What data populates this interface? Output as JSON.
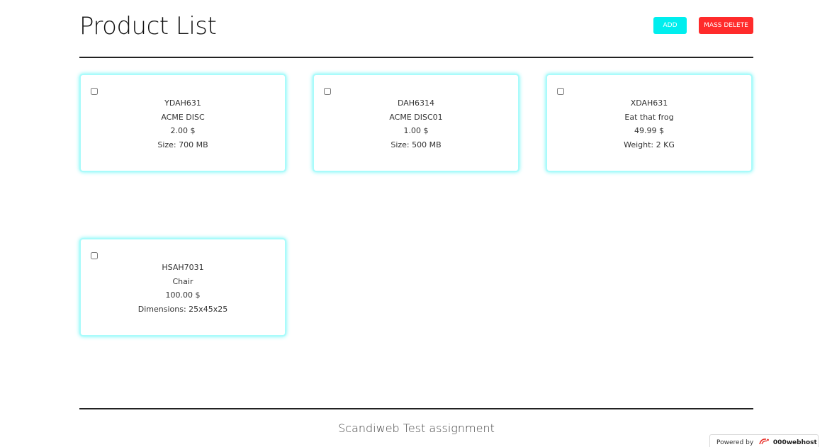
{
  "header": {
    "title": "Product List",
    "add_label": "ADD",
    "mass_delete_label": "MASS DELETE"
  },
  "products": [
    {
      "sku": "YDAH631",
      "name": "ACME DISC",
      "price": "2.00 $",
      "attribute": "Size: 700 MB"
    },
    {
      "sku": "DAH6314",
      "name": "ACME DISC01",
      "price": "1.00 $",
      "attribute": "Size: 500 MB"
    },
    {
      "sku": "XDAH631",
      "name": "Eat that frog",
      "price": "49.99 $",
      "attribute": "Weight: 2 KG"
    },
    {
      "sku": "HSAH7031",
      "name": "Chair",
      "price": "100.00 $",
      "attribute": "Dimensions: 25x45x25"
    }
  ],
  "footer": {
    "text": "Scandiweb Test assignment"
  },
  "badge": {
    "powered_by": "Powered by",
    "brand": "000webhost",
    "icon": "000webhost-logo-icon"
  },
  "colors": {
    "add_button": "#00eeee",
    "mass_delete_button": "#ff2b2b",
    "card_glow": "#a9fbfb"
  }
}
